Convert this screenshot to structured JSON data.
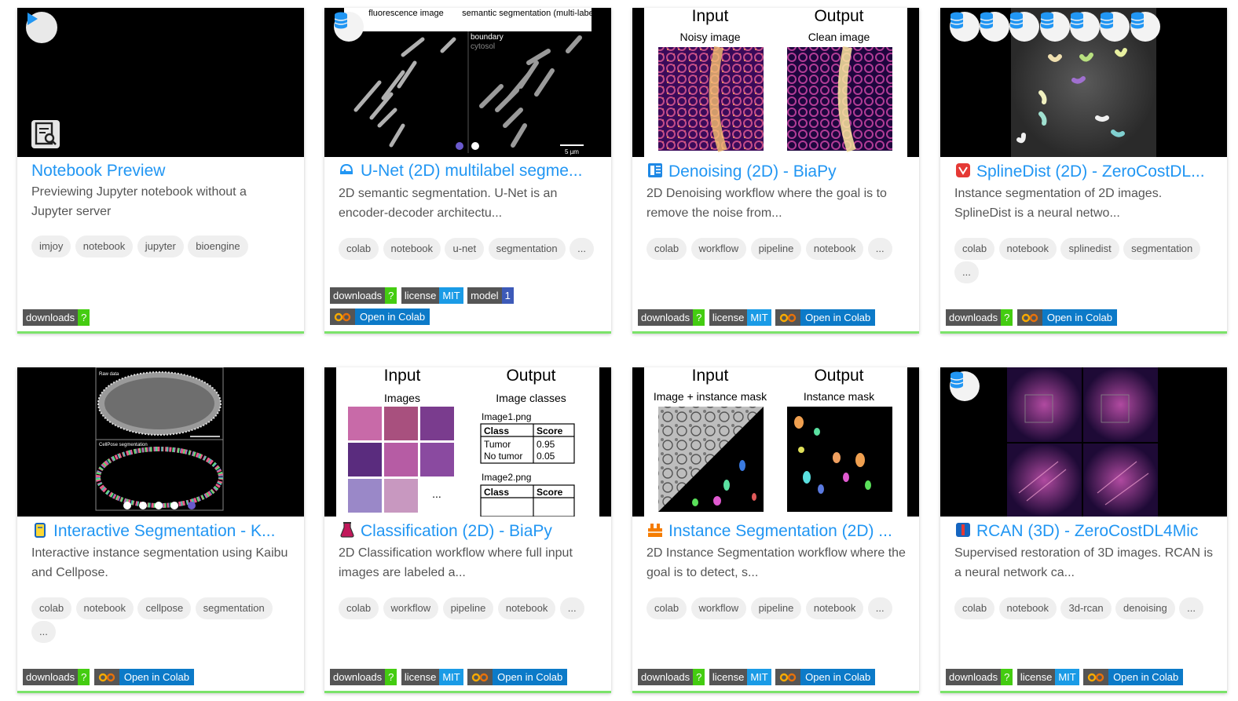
{
  "cards": [
    {
      "title": "Notebook Preview",
      "description": "Previewing Jupyter notebook without a Jupyter server",
      "tags": [
        "imjoy",
        "notebook",
        "jupyter",
        "bioengine"
      ],
      "badges": {
        "downloads_label": "downloads",
        "downloads_value": "?"
      }
    },
    {
      "title": "U-Net (2D) multilabel segme...",
      "description": "2D semantic segmentation. U-Net is an encoder-decoder architectu...",
      "tags": [
        "colab",
        "notebook",
        "u-net",
        "segmentation",
        "..."
      ],
      "thumb_text": {
        "left": "fluorescence image",
        "right": "semantic segmentation (multi-label)",
        "boundary": "boundary",
        "cytosol": "cytosol",
        "scale": "5 µm"
      },
      "badges": {
        "downloads_label": "downloads",
        "downloads_value": "?",
        "license_label": "license",
        "license_value": "MIT",
        "model_label": "model",
        "model_value": "1",
        "colab": "Open in Colab"
      }
    },
    {
      "title": "Denoising (2D) - BiaPy",
      "description": "2D Denoising workflow where the goal is to remove the noise from...",
      "tags": [
        "colab",
        "workflow",
        "pipeline",
        "notebook",
        "..."
      ],
      "thumb_text": {
        "input": "Input",
        "output": "Output",
        "in_sub": "Noisy image",
        "out_sub": "Clean image"
      },
      "badges": {
        "downloads_label": "downloads",
        "downloads_value": "?",
        "license_label": "license",
        "license_value": "MIT",
        "colab": "Open in Colab"
      }
    },
    {
      "title": "SplineDist (2D) - ZeroCostDL...",
      "description": "Instance segmentation of 2D images. SplineDist is a neural netwo...",
      "tags": [
        "colab",
        "notebook",
        "splinedist",
        "segmentation",
        "..."
      ],
      "badges": {
        "downloads_label": "downloads",
        "downloads_value": "?",
        "colab": "Open in Colab"
      }
    },
    {
      "title": "Interactive Segmentation - K...",
      "description": "Interactive instance segmentation using Kaibu and Cellpose.",
      "tags": [
        "colab",
        "notebook",
        "cellpose",
        "segmentation",
        "..."
      ],
      "thumb_text": {
        "top": "Raw data",
        "bottom": "CellPose segmentation"
      },
      "badges": {
        "downloads_label": "downloads",
        "downloads_value": "?",
        "colab": "Open in Colab"
      }
    },
    {
      "title": "Classification (2D) - BiaPy",
      "description": "2D Classification workflow where full input images are labeled a...",
      "tags": [
        "colab",
        "workflow",
        "pipeline",
        "notebook",
        "..."
      ],
      "thumb_text": {
        "input": "Input",
        "output": "Output",
        "in_sub": "Images",
        "out_sub": "Image classes",
        "img1": "Image1.png",
        "img2": "Image2.png",
        "class": "Class",
        "score": "Score",
        "tumor": "Tumor",
        "no_tumor": "No tumor",
        "s1": "0.95",
        "s2": "0.05",
        "dots": "..."
      },
      "badges": {
        "downloads_label": "downloads",
        "downloads_value": "?",
        "license_label": "license",
        "license_value": "MIT",
        "colab": "Open in Colab"
      }
    },
    {
      "title": "Instance Segmentation (2D) ...",
      "description": "2D Instance Segmentation workflow where the goal is to detect, s...",
      "tags": [
        "colab",
        "workflow",
        "pipeline",
        "notebook",
        "..."
      ],
      "thumb_text": {
        "input": "Input",
        "output": "Output",
        "in_sub": "Image + instance mask",
        "out_sub": "Instance mask"
      },
      "badges": {
        "downloads_label": "downloads",
        "downloads_value": "?",
        "license_label": "license",
        "license_value": "MIT",
        "colab": "Open in Colab"
      }
    },
    {
      "title": "RCAN (3D) - ZeroCostDL4Mic",
      "description": "Supervised restoration of 3D images. RCAN is a neural network ca...",
      "tags": [
        "colab",
        "notebook",
        "3d-rcan",
        "denoising",
        "..."
      ],
      "badges": {
        "downloads_label": "downloads",
        "downloads_value": "?",
        "license_label": "license",
        "license_value": "MIT",
        "colab": "Open in Colab"
      }
    }
  ],
  "colors": {
    "title": "#2196f3",
    "card_border": "#7be36a",
    "badge_ok": "#44cc11",
    "badge_mit": "#1a9be6",
    "colab": "#0c7ac8"
  }
}
